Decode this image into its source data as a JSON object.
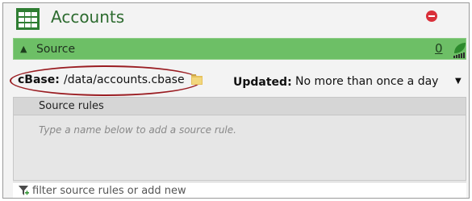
{
  "window": {
    "title": "Accounts",
    "icon": "table-grid-icon",
    "close_icon": "remove-circle-icon"
  },
  "source_section": {
    "label": "Source",
    "expand_icon": "chevron-up-icon",
    "count": "0",
    "status_icon": "leaf-signal-icon",
    "accent_color": "#6dbf66"
  },
  "cbase": {
    "label": "cBase:",
    "value": "/data/accounts.cbase",
    "folder_icon": "folder-icon"
  },
  "updated": {
    "label": "Updated:",
    "value": "No more than once a day"
  },
  "source_rules": {
    "header": "Source rules",
    "hint": "Type a name below to add a source rule."
  },
  "filter": {
    "placeholder": "filter source rules or add new",
    "icon": "filter-add-icon"
  }
}
